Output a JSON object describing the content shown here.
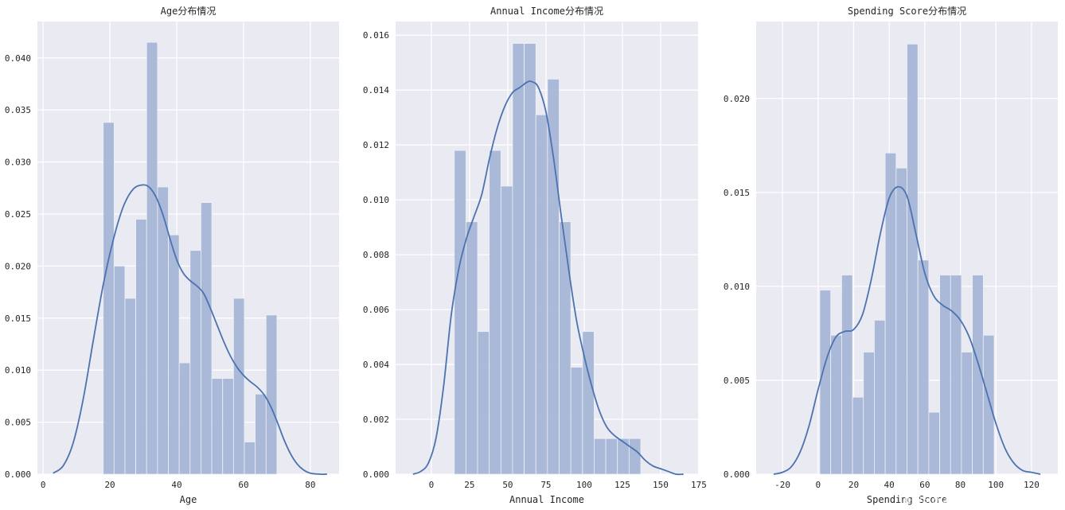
{
  "chart_data": [
    {
      "type": "bar",
      "subtype": "histogram-with-kde",
      "title": "Age分布情况",
      "xlabel": "Age",
      "ylabel": "",
      "xlim": [
        -1.7,
        88.6
      ],
      "ylim": [
        0,
        0.0435
      ],
      "xticks": [
        0,
        20,
        40,
        60,
        80
      ],
      "xtick_labels": [
        "0",
        "20",
        "40",
        "60",
        "80"
      ],
      "yticks": [
        0,
        0.005,
        0.01,
        0.015,
        0.02,
        0.025,
        0.03,
        0.035,
        0.04
      ],
      "ytick_labels": [
        "0.000",
        "0.005",
        "0.010",
        "0.015",
        "0.020",
        "0.025",
        "0.030",
        "0.035",
        "0.040"
      ],
      "grid": true,
      "bins": {
        "start": 18,
        "end": 70,
        "count": 16
      },
      "values": [
        0.0338,
        0.02,
        0.0169,
        0.0245,
        0.0415,
        0.0276,
        0.023,
        0.0107,
        0.0215,
        0.0261,
        0.0092,
        0.0092,
        0.0169,
        0.0031,
        0.0077,
        0.0153
      ],
      "kde": {
        "x": [
          3,
          6,
          9,
          12,
          15,
          18,
          21,
          24,
          27,
          30,
          32,
          34,
          36,
          38,
          40,
          42,
          44,
          46,
          48,
          50,
          52,
          54,
          56,
          58,
          60,
          62,
          64,
          66,
          68,
          70,
          72,
          74,
          76,
          78,
          80,
          83,
          85
        ],
        "y": [
          0.0001,
          0.0008,
          0.003,
          0.0072,
          0.0128,
          0.0182,
          0.0225,
          0.0257,
          0.0274,
          0.0278,
          0.0275,
          0.0265,
          0.0248,
          0.0226,
          0.0206,
          0.0193,
          0.0186,
          0.0181,
          0.0174,
          0.016,
          0.0144,
          0.0128,
          0.0114,
          0.0103,
          0.0095,
          0.0089,
          0.0084,
          0.0077,
          0.0066,
          0.0051,
          0.0034,
          0.002,
          0.001,
          0.0004,
          0.0001,
          0.0,
          0.0
        ]
      }
    },
    {
      "type": "bar",
      "subtype": "histogram-with-kde",
      "title": "Annual Income分布情况",
      "xlabel": "Annual Income",
      "ylabel": "",
      "xlim": [
        -23.4,
        174.5
      ],
      "ylim": [
        0,
        0.0165
      ],
      "xticks": [
        0,
        25,
        50,
        75,
        100,
        125,
        150,
        175
      ],
      "xtick_labels": [
        "0",
        "25",
        "50",
        "75",
        "100",
        "125",
        "150",
        "175"
      ],
      "yticks": [
        0,
        0.002,
        0.004,
        0.006,
        0.008,
        0.01,
        0.012,
        0.014,
        0.016
      ],
      "ytick_labels": [
        "0.000",
        "0.002",
        "0.004",
        "0.006",
        "0.008",
        "0.010",
        "0.012",
        "0.014",
        "0.016"
      ],
      "grid": true,
      "bins": {
        "start": 15,
        "end": 137,
        "count": 16
      },
      "values": [
        0.0118,
        0.0092,
        0.0052,
        0.0118,
        0.0105,
        0.0157,
        0.0157,
        0.0131,
        0.0144,
        0.0092,
        0.0039,
        0.0052,
        0.0013,
        0.0013,
        0.0013,
        0.0013
      ],
      "kde": {
        "x": [
          -12,
          -7,
          -2,
          3,
          8,
          13,
          18,
          23,
          28,
          33,
          38,
          43,
          48,
          53,
          58,
          63,
          66,
          70,
          75,
          80,
          85,
          90,
          95,
          100,
          105,
          110,
          115,
          120,
          125,
          130,
          135,
          140,
          145,
          150,
          155,
          160,
          165
        ],
        "y": [
          0.0,
          0.0001,
          0.0004,
          0.0013,
          0.0032,
          0.0058,
          0.0075,
          0.0086,
          0.0094,
          0.0102,
          0.0115,
          0.0126,
          0.0134,
          0.0139,
          0.0141,
          0.0143,
          0.0143,
          0.0141,
          0.0132,
          0.0115,
          0.0094,
          0.0074,
          0.0056,
          0.0043,
          0.0032,
          0.0023,
          0.0017,
          0.0014,
          0.0012,
          0.001,
          0.0008,
          0.0005,
          0.0003,
          0.0002,
          0.0001,
          0.0,
          0.0
        ]
      }
    },
    {
      "type": "bar",
      "subtype": "histogram-with-kde",
      "title": "Spending Score分布情况",
      "xlabel": "Spending Score",
      "ylabel": "",
      "xlim": [
        -34.8,
        134.8
      ],
      "ylim": [
        0,
        0.0241
      ],
      "xticks": [
        -20,
        0,
        20,
        40,
        60,
        80,
        100,
        120
      ],
      "xtick_labels": [
        "-20",
        "0",
        "20",
        "40",
        "60",
        "80",
        "100",
        "120"
      ],
      "yticks": [
        0,
        0.005,
        0.01,
        0.015,
        0.02
      ],
      "ytick_labels": [
        "0.000",
        "0.005",
        "0.010",
        "0.015",
        "0.020"
      ],
      "grid": true,
      "bins": {
        "start": 1,
        "end": 99,
        "count": 16
      },
      "values": [
        0.0098,
        0.0074,
        0.0106,
        0.0041,
        0.0065,
        0.0082,
        0.0171,
        0.0163,
        0.0229,
        0.0114,
        0.0033,
        0.0106,
        0.0106,
        0.0065,
        0.0106,
        0.0074
      ],
      "kde": {
        "x": [
          -25,
          -20,
          -15,
          -10,
          -5,
          0,
          5,
          10,
          15,
          20,
          25,
          30,
          35,
          40,
          45,
          50,
          55,
          60,
          65,
          70,
          75,
          80,
          85,
          90,
          95,
          100,
          105,
          110,
          115,
          120,
          125
        ],
        "y": [
          0.0,
          0.0001,
          0.0004,
          0.0012,
          0.0026,
          0.0045,
          0.0062,
          0.0073,
          0.0076,
          0.0077,
          0.0085,
          0.0104,
          0.0128,
          0.0147,
          0.0153,
          0.0148,
          0.0128,
          0.0107,
          0.0095,
          0.009,
          0.0087,
          0.0082,
          0.0073,
          0.0059,
          0.0043,
          0.0027,
          0.0014,
          0.0006,
          0.0002,
          0.0001,
          0.0
        ]
      }
    }
  ],
  "colors": {
    "axes_bg": "#EAEAF2",
    "grid": "#FFFFFF",
    "bar_fill": "#A6B7D6",
    "kde_line": "#4C72B0",
    "text": "#262626"
  },
  "watermark": "https://blog.csdn.net/lam_yx"
}
